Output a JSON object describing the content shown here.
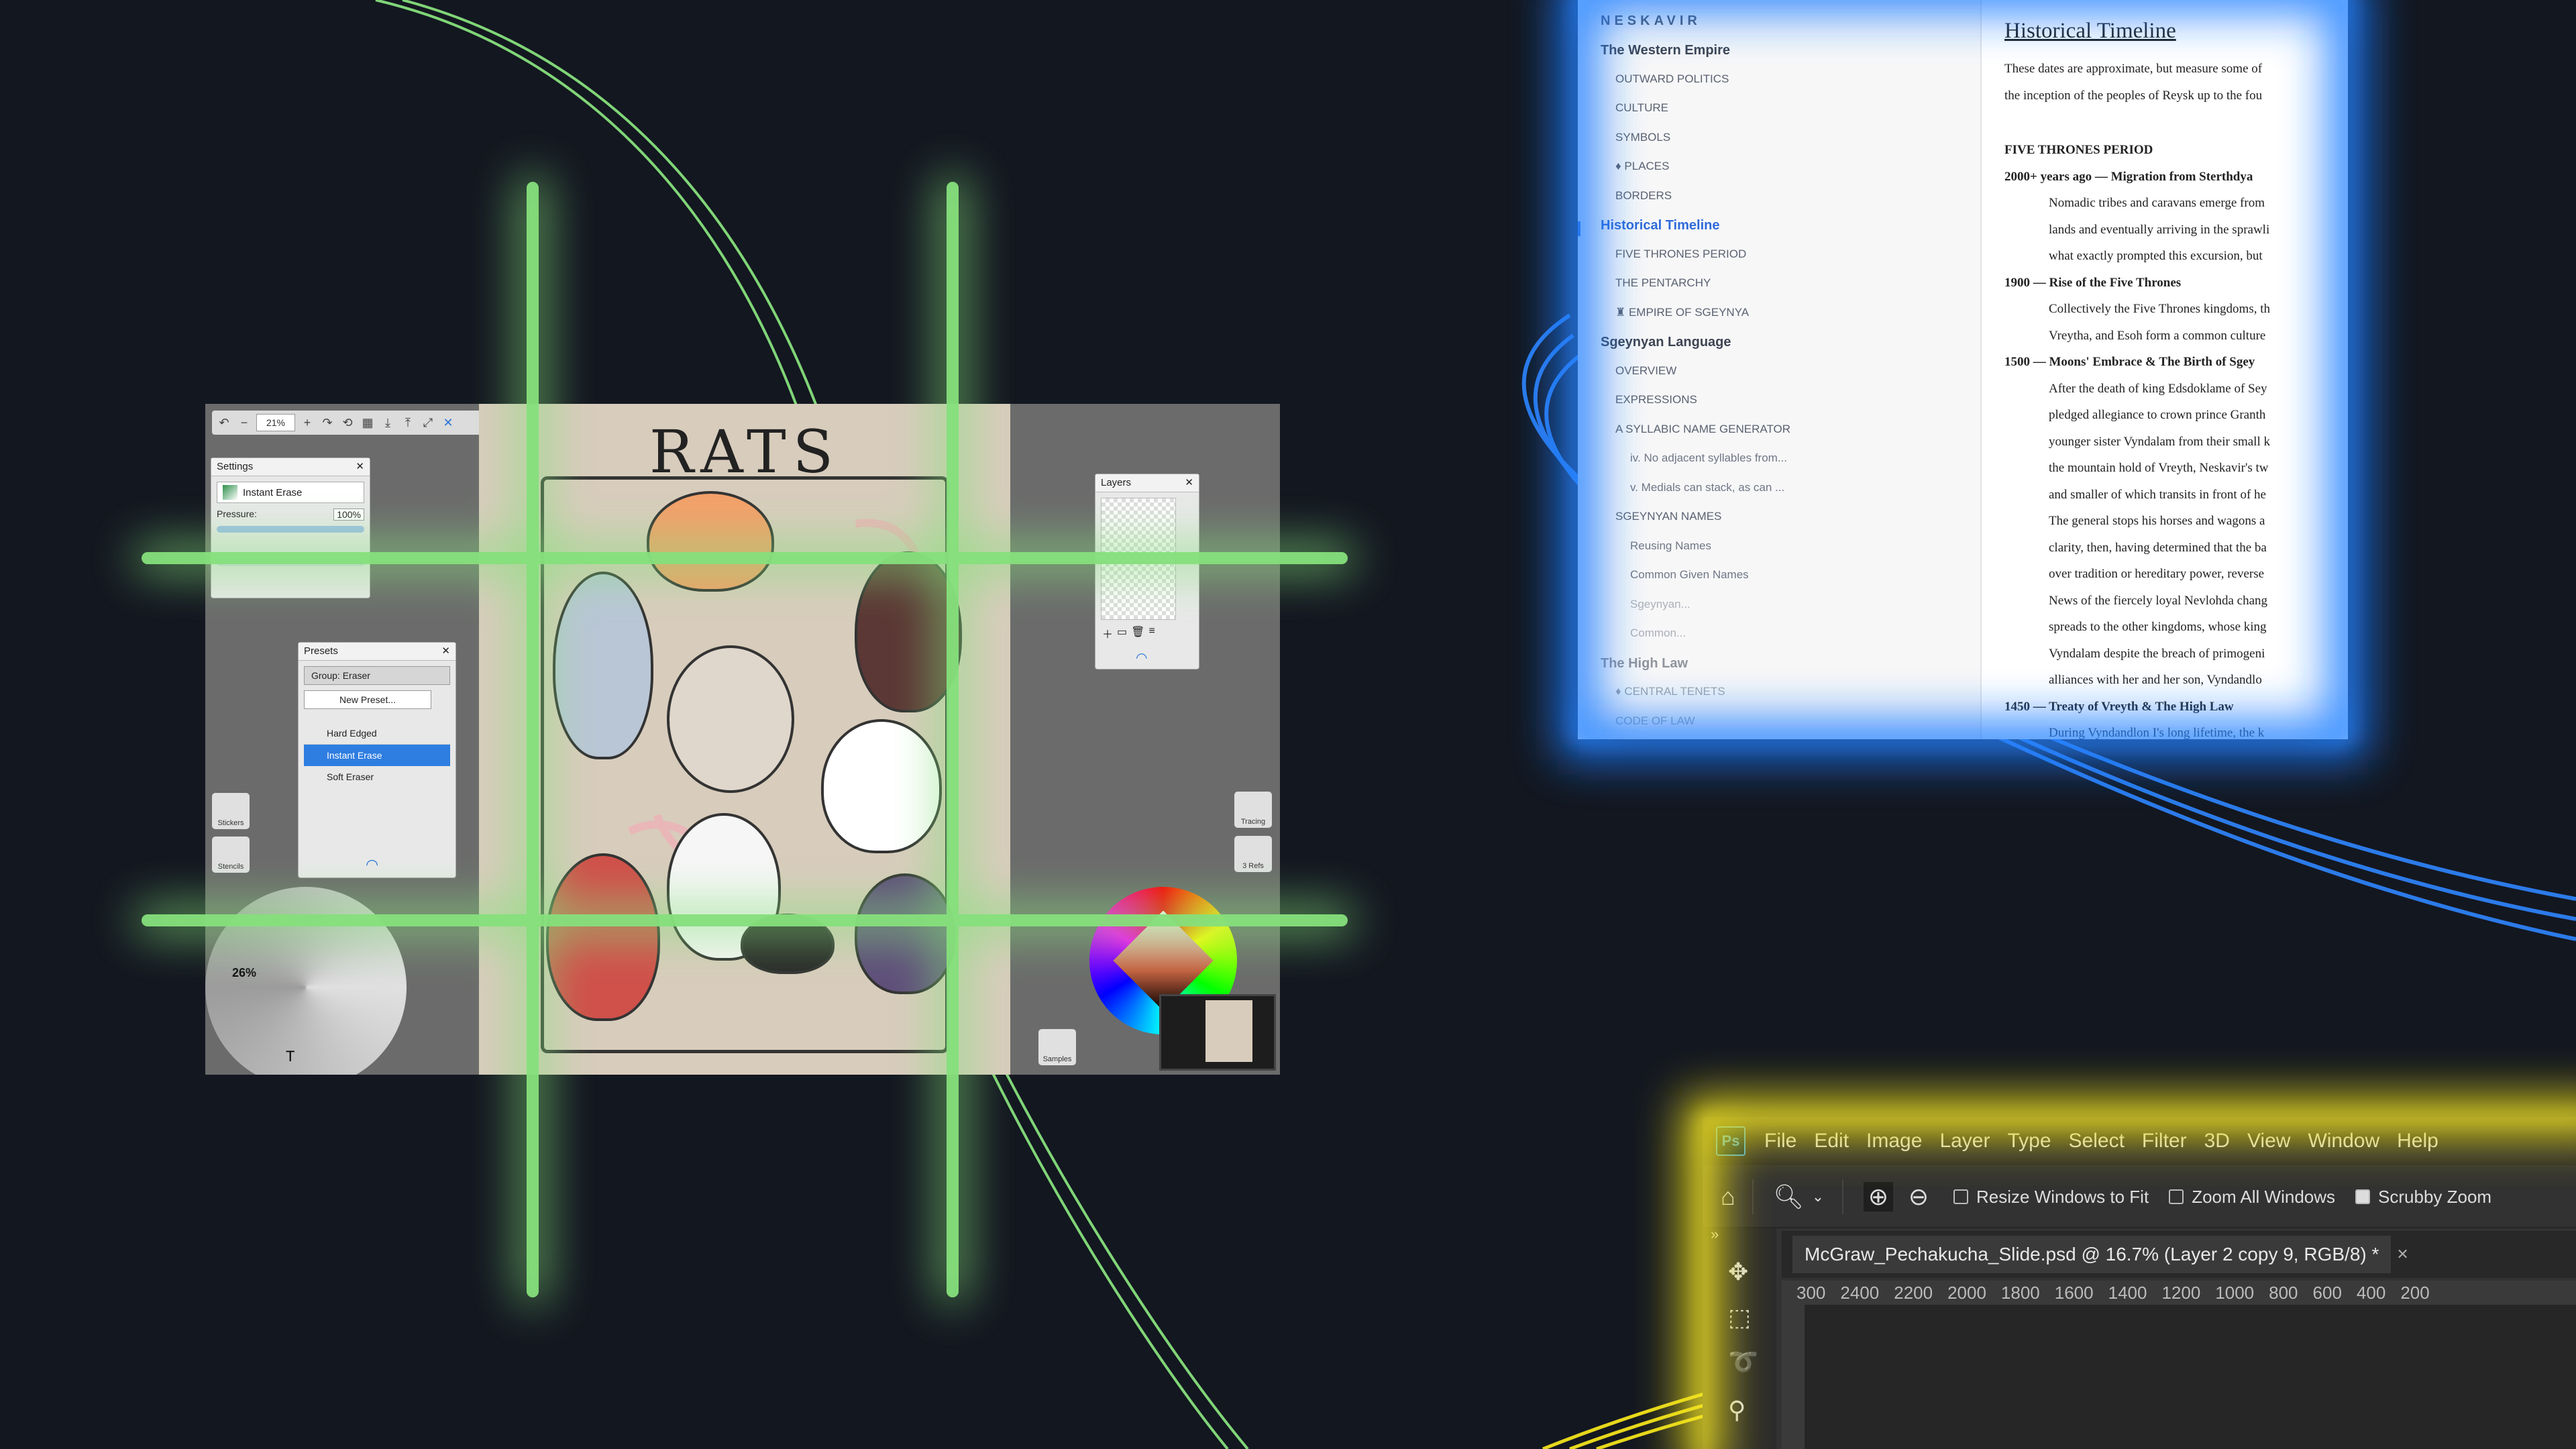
{
  "colors": {
    "background": "#131720",
    "green_glow": "#86e07c",
    "blue_glow": "#1d7bff",
    "yellow_glow": "#f2e21c",
    "doc_accent": "#2f6bd9"
  },
  "artrage": {
    "zoom": "21%",
    "settings_panel": {
      "title": "Settings",
      "tool": "Instant Erase",
      "pressure_label": "Pressure:",
      "pressure_value": "100%"
    },
    "presets_panel": {
      "title": "Presets",
      "group": "Group: Eraser",
      "new_preset": "New Preset...",
      "items": [
        "Hard Edged",
        "Instant Erase",
        "Soft Eraser"
      ]
    },
    "layers_panel": {
      "title": "Layers"
    },
    "canvas_title": "RATS",
    "left_buttons": [
      "Stickers",
      "Stencils"
    ],
    "right_buttons": [
      "Tracing",
      "3 Refs"
    ],
    "samples_label": "Samples",
    "tool_wheel_percent": "26%",
    "tool_wheel_letter": "T"
  },
  "doc": {
    "brand": "NESKAVIR",
    "nav": [
      {
        "label": "The Western Empire",
        "level": "top"
      },
      {
        "label": "OUTWARD POLITICS",
        "level": "sub"
      },
      {
        "label": "CULTURE",
        "level": "sub"
      },
      {
        "label": "SYMBOLS",
        "level": "sub"
      },
      {
        "label": "♦ PLACES",
        "level": "sub"
      },
      {
        "label": "BORDERS",
        "level": "sub"
      },
      {
        "label": "Historical Timeline",
        "level": "active"
      },
      {
        "label": "FIVE THRONES PERIOD",
        "level": "sub"
      },
      {
        "label": "THE PENTARCHY",
        "level": "sub"
      },
      {
        "label": "♜ EMPIRE OF SGEYNYA",
        "level": "sub"
      },
      {
        "label": "Sgeynyan Language",
        "level": "top"
      },
      {
        "label": "OVERVIEW",
        "level": "sub"
      },
      {
        "label": "EXPRESSIONS",
        "level": "sub"
      },
      {
        "label": "A SYLLABIC NAME GENERATOR",
        "level": "sub"
      },
      {
        "label": "iv. No adjacent syllables from...",
        "level": "sub2"
      },
      {
        "label": "v. Medials can stack, as can ...",
        "level": "sub2"
      },
      {
        "label": "SGEYNYAN NAMES",
        "level": "sub"
      },
      {
        "label": "Reusing Names",
        "level": "sub2"
      },
      {
        "label": "Common Given Names",
        "level": "sub2"
      },
      {
        "label": "Sgeynyan...",
        "level": "sub2"
      },
      {
        "label": "Common...",
        "level": "sub2"
      },
      {
        "label": "The High Law",
        "level": "top"
      },
      {
        "label": "♦ CENTRAL TENETS",
        "level": "sub"
      },
      {
        "label": "CODE OF LAW",
        "level": "sub"
      }
    ],
    "heading": "Historical Timeline",
    "lines": [
      {
        "text": "These dates are approximate, but measure some of",
        "style": "p"
      },
      {
        "text": "the inception of the peoples of Reysk up to the fou",
        "style": "p"
      },
      {
        "text": "FIVE THRONES PERIOD",
        "style": "bold"
      },
      {
        "text": "2000+ years ago — Migration from Sterthdya",
        "style": "bold"
      },
      {
        "text": "Nomadic tribes and caravans emerge from",
        "style": "ind"
      },
      {
        "text": "lands and eventually arriving in the sprawli",
        "style": "ind"
      },
      {
        "text": "what exactly prompted this excursion, but",
        "style": "ind"
      },
      {
        "text": "1900 — Rise of the Five Thrones",
        "style": "bold"
      },
      {
        "text": "Collectively the Five Thrones kingdoms, th",
        "style": "ind"
      },
      {
        "text": "Vreytha, and Esoh form a common culture",
        "style": "ind"
      },
      {
        "text": "1500 — Moons' Embrace & The Birth of Sgey",
        "style": "bold"
      },
      {
        "text": "After the death of king Edsdoklame of Sey",
        "style": "ind"
      },
      {
        "text": "pledged allegiance to crown prince Granth",
        "style": "ind"
      },
      {
        "text": "younger sister Vyndalam from their small k",
        "style": "ind"
      },
      {
        "text": "the mountain hold of Vreyth, Neskavir's tw",
        "style": "ind"
      },
      {
        "text": "and smaller of which transits in front of he",
        "style": "ind"
      },
      {
        "text": "The general stops his horses and wagons a",
        "style": "ind"
      },
      {
        "text": "clarity, then, having determined that the ba",
        "style": "ind"
      },
      {
        "text": "over tradition or hereditary power, reverse",
        "style": "ind"
      },
      {
        "text": "News of the fiercely loyal Nevlohda chang",
        "style": "ind"
      },
      {
        "text": "spreads to the other kingdoms, whose king",
        "style": "ind"
      },
      {
        "text": "Vyndalam despite the breach of primogeni",
        "style": "ind"
      },
      {
        "text": "alliances with her and her son, Vyndandlo",
        "style": "ind"
      },
      {
        "text": "1450 — Treaty of Vreyth & The High Law",
        "style": "bold"
      },
      {
        "text": "During Vyndandlon I's long lifetime, the k",
        "style": "ind"
      }
    ]
  },
  "photoshop": {
    "logo": "Ps",
    "menu": [
      "File",
      "Edit",
      "Image",
      "Layer",
      "Type",
      "Select",
      "Filter",
      "3D",
      "View",
      "Window",
      "Help"
    ],
    "options": [
      {
        "label": "Resize Windows to Fit",
        "checked": false
      },
      {
        "label": "Zoom All Windows",
        "checked": false
      },
      {
        "label": "Scrubby Zoom",
        "checked": true
      }
    ],
    "tab_title": "McGraw_Pechakucha_Slide.psd @ 16.7% (Layer 2 copy 9, RGB/8) *",
    "ruler_ticks": [
      "300",
      "2400",
      "2200",
      "2000",
      "1800",
      "1600",
      "1400",
      "1200",
      "1000",
      "800",
      "600",
      "400",
      "200"
    ]
  }
}
